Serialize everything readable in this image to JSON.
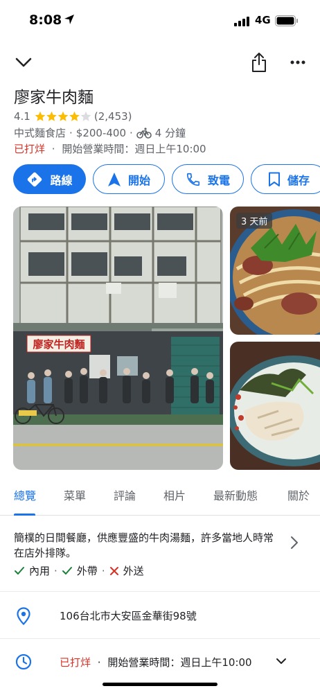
{
  "status_bar": {
    "time": "8:08",
    "network": "4G",
    "icons": [
      "location-arrow-icon",
      "signal-icon",
      "battery-icon"
    ]
  },
  "top_bar": {
    "icons": [
      "chevron-down-icon",
      "share-icon",
      "more-icon"
    ]
  },
  "place": {
    "name": "廖家牛肉麵",
    "rating": "4.1",
    "rating_value": 4.1,
    "rating_max": 5,
    "review_count": "(2,453)",
    "category": "中式麵食店",
    "price": "$200-400",
    "travel_time": "4 分鐘",
    "status": "已打烊",
    "hours_text": "開始營業時間：週日上午10:00"
  },
  "actions": [
    {
      "label": "路線",
      "icon": "directions-icon"
    },
    {
      "label": "開始",
      "icon": "navigation-icon"
    },
    {
      "label": "致電",
      "icon": "phone-icon"
    },
    {
      "label": "儲存",
      "icon": "bookmark-icon"
    }
  ],
  "photos": {
    "badge": "3 天前",
    "sign_text": "廖家牛肉麵"
  },
  "tabs": [
    "總覽",
    "菜單",
    "評論",
    "相片",
    "最新動態",
    "關於"
  ],
  "active_tab": "總覽",
  "overview": {
    "description": "簡樸的日間餐廳，供應豐盛的牛肉湯麵，許多當地人時常在店外排隊。",
    "services": [
      {
        "label": "內用",
        "available": true
      },
      {
        "label": "外帶",
        "available": true
      },
      {
        "label": "外送",
        "available": false
      }
    ],
    "address": "106台北市大安區金華街98號",
    "status": "已打烊",
    "hours_text": "開始營業時間：週日上午10:00"
  },
  "colors": {
    "accent": "#1a73e8",
    "closed": "#d93025",
    "star": "#fbbc04",
    "check": "#188038",
    "cross": "#d93025"
  }
}
